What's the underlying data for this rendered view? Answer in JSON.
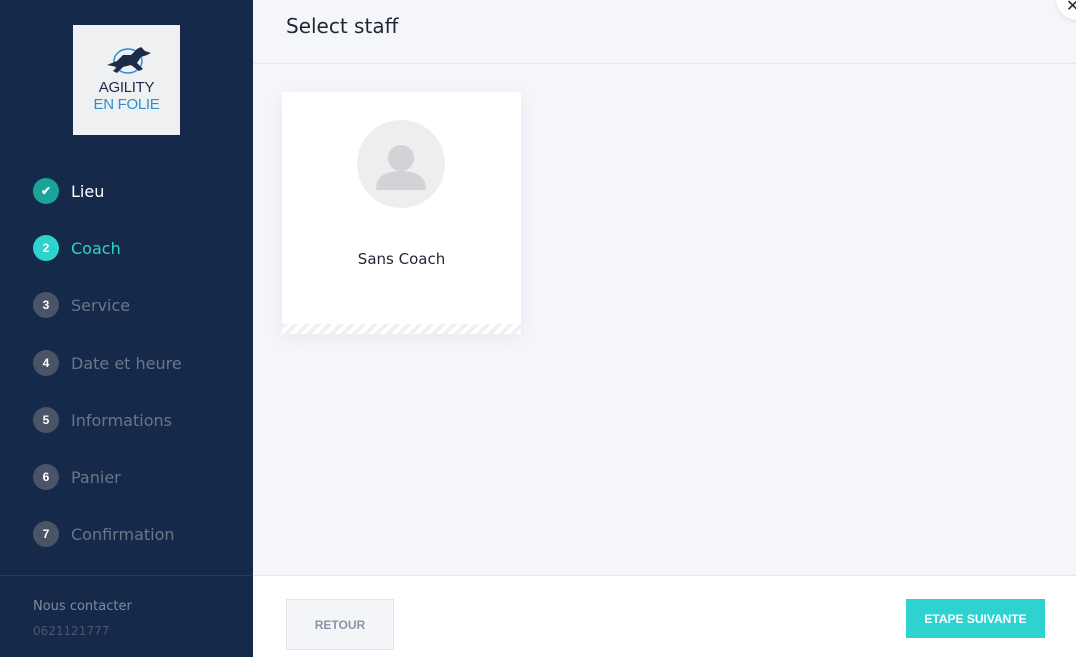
{
  "sidebar": {
    "logo": {
      "line1": "AGILITY",
      "line2": "EN FOLIE"
    },
    "steps": [
      {
        "num": "✔",
        "label": "Lieu",
        "state": "done"
      },
      {
        "num": "2",
        "label": "Coach",
        "state": "active"
      },
      {
        "num": "3",
        "label": "Service",
        "state": "pending"
      },
      {
        "num": "4",
        "label": "Date et heure",
        "state": "pending"
      },
      {
        "num": "5",
        "label": "Informations",
        "state": "pending"
      },
      {
        "num": "6",
        "label": "Panier",
        "state": "pending"
      },
      {
        "num": "7",
        "label": "Confirmation",
        "state": "pending"
      }
    ],
    "contact": {
      "title": "Nous contacter",
      "phone": "0621121777"
    }
  },
  "header": {
    "title": "Select staff",
    "close_icon": "close-icon"
  },
  "staff": [
    {
      "name": "Sans Coach",
      "avatar_icon": "user-placeholder-icon"
    }
  ],
  "footer": {
    "back_label": "RETOUR",
    "next_label": "ETAPE SUIVANTE"
  },
  "colors": {
    "sidebar_bg": "#15294a",
    "accent": "#2ed3d0",
    "done": "#1ba39a",
    "pending": "#4a5466"
  }
}
